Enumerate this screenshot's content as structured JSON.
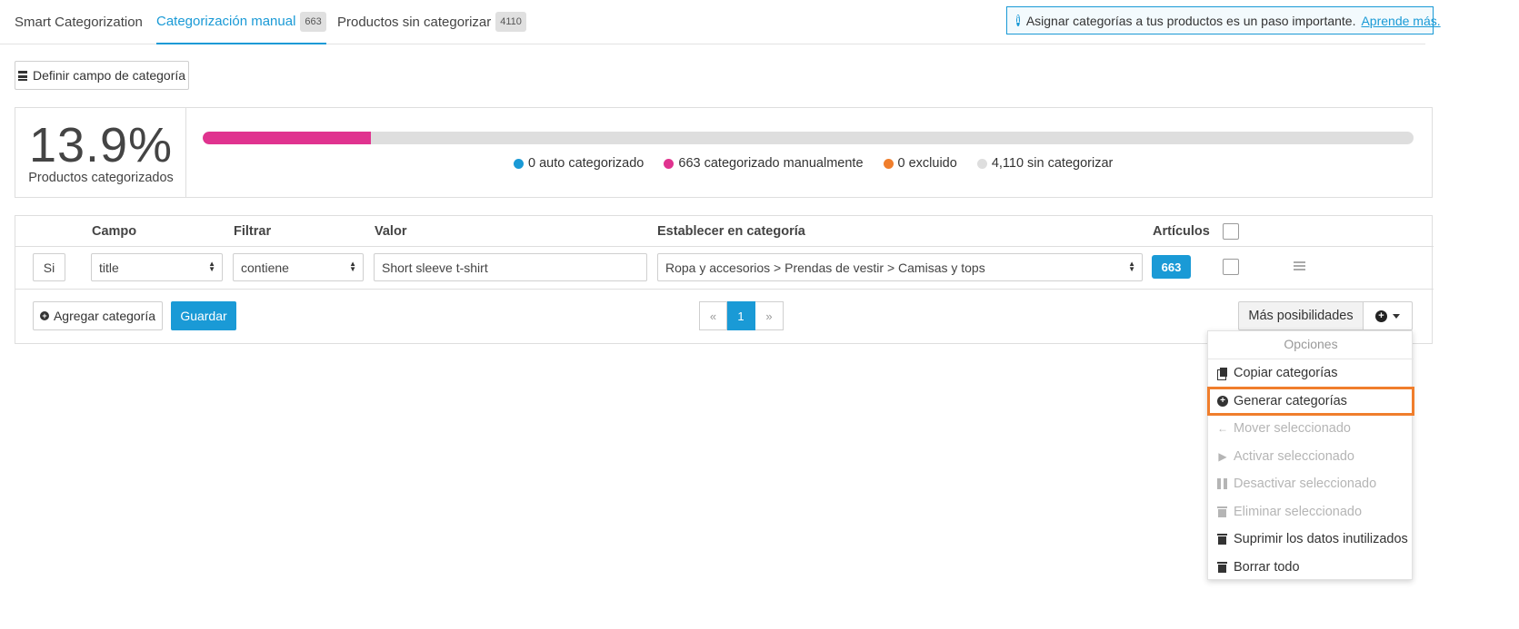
{
  "tabs": [
    {
      "label": "Smart Categorization",
      "count": ""
    },
    {
      "label": "Categorización manual",
      "count": "663"
    },
    {
      "label": "Productos sin categorizar",
      "count": "4110"
    }
  ],
  "banner": {
    "text": "Asignar categorías a tus productos es un paso importante.",
    "link": "Aprende más."
  },
  "define_button": "Definir campo de categoría",
  "stats": {
    "percent_text": "13.9%",
    "caption": "Productos categorizados",
    "progress_fraction": 0.139,
    "legend": [
      {
        "label": "0 auto categorizado",
        "color": "#1a9ad6"
      },
      {
        "label": "663 categorizado manualmente",
        "color": "#e0338f"
      },
      {
        "label": "0 excluido",
        "color": "#f07e2c"
      },
      {
        "label": "4,110 sin categorizar",
        "color": "#dedede"
      }
    ]
  },
  "table": {
    "headers": {
      "campo": "Campo",
      "filtrar": "Filtrar",
      "valor": "Valor",
      "categoria": "Establecer en categoría",
      "articulos": "Artículos"
    },
    "row": {
      "prefix": "Si",
      "campo": "title",
      "filtrar": "contiene",
      "valor": "Short sleeve t-shirt",
      "categoria": "Ropa y accesorios > Prendas de vestir > Camisas y tops",
      "articulos": "663"
    }
  },
  "actions": {
    "add_category": "Agregar categoría",
    "save": "Guardar",
    "pager": {
      "prev": "«",
      "current": "1",
      "next": "»"
    },
    "more": "Más posibilidades"
  },
  "menu": {
    "header": "Opciones",
    "items": [
      {
        "label": "Copiar categorías",
        "icon": "copy-icon",
        "enabled": true
      },
      {
        "label": "Generar categorías",
        "icon": "plus-circle-icon",
        "enabled": true,
        "highlighted": true
      },
      {
        "label": "Mover seleccionado",
        "icon": "arrow-left-icon",
        "enabled": false
      },
      {
        "label": "Activar seleccionado",
        "icon": "play-icon",
        "enabled": false
      },
      {
        "label": "Desactivar seleccionado",
        "icon": "pause-icon",
        "enabled": false
      },
      {
        "label": "Eliminar seleccionado",
        "icon": "trash-icon",
        "enabled": false
      },
      {
        "label": "Suprimir los datos inutilizados",
        "icon": "trash-icon",
        "enabled": true
      },
      {
        "label": "Borrar todo",
        "icon": "trash-icon",
        "enabled": true
      }
    ]
  },
  "colors": {
    "accent": "#1a9ad6",
    "manual": "#e0338f",
    "excluded": "#f07e2c",
    "highlight": "#f07e2c"
  }
}
